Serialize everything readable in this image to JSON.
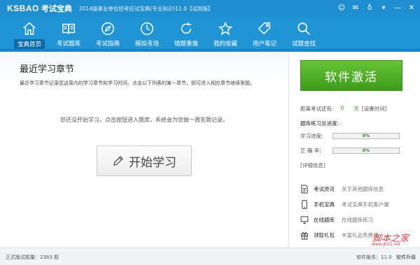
{
  "window": {
    "logo": "KSBAO",
    "logo_sub": "考试宝典",
    "title": "2014版事业单位招考应试宝典(专业知识)11.0【试用版】",
    "controls": [
      {
        "icon": "user-icon",
        "glyph": "☺"
      },
      {
        "icon": "feedback-icon",
        "glyph": "✉"
      },
      {
        "icon": "bulb-icon",
        "glyph": "♁"
      },
      {
        "icon": "menu-icon",
        "glyph": "▾"
      },
      {
        "icon": "minimize-icon",
        "glyph": "—"
      },
      {
        "icon": "close-icon",
        "glyph": "✕"
      }
    ]
  },
  "nav": {
    "items": [
      {
        "label": "宝典首页",
        "icon": "home-icon",
        "active": true
      },
      {
        "label": "考试题库",
        "icon": "book-icon"
      },
      {
        "label": "考试指南",
        "icon": "compass-icon"
      },
      {
        "label": "模拟考场",
        "icon": "clock-icon"
      },
      {
        "label": "错题重做",
        "icon": "redo-icon"
      },
      {
        "label": "我的收藏",
        "icon": "star-icon"
      },
      {
        "label": "用户笔记",
        "icon": "tag-icon"
      },
      {
        "label": "试题查找",
        "icon": "search-icon"
      }
    ]
  },
  "main": {
    "title": "最近学习章节",
    "desc": "最近学习章节记录您这周内的学习章节和学习时间，点击以下列表的某一章节，即可进入相应章节继续答题。",
    "empty_msg": "您还没开始学习，点击按钮进入题库，系统会为您做一周答题记录。",
    "start_label": "开始学习"
  },
  "sidebar": {
    "activate_label": "软件激活",
    "exam_prefix": "距离考试还有:",
    "exam_days": "0",
    "exam_unit": "天",
    "exam_link": "[设置时间]",
    "progress_title": "题库练习总进度:",
    "progress": [
      {
        "label": "学习进度:",
        "percent_text": "0%",
        "value": 0
      },
      {
        "label": "正 确 率:",
        "percent_text": "0%",
        "value": 0
      }
    ],
    "detail_link": "[详细信息]",
    "links": [
      {
        "name": "考试资讯",
        "desc": "关于其他题库信息",
        "icon": "document-icon"
      },
      {
        "name": "手机宝典",
        "desc": "考试宝典手机客户端",
        "icon": "phone-icon"
      },
      {
        "name": "在线题库",
        "desc": "在线题库练习",
        "icon": "monitor-icon"
      },
      {
        "name": "领取礼包",
        "desc": "丰富礼品免费领",
        "icon": "gift-icon"
      }
    ]
  },
  "status": {
    "question_count": "正式版试题量：2383 题",
    "version": "软件版本：11.0",
    "upgrade": "软件升级"
  },
  "watermark": {
    "text": "脚本之家",
    "url": "www.jb51.net"
  },
  "colors": {
    "nav_blue": "#2194d6",
    "activate_green": "#4fae25"
  }
}
